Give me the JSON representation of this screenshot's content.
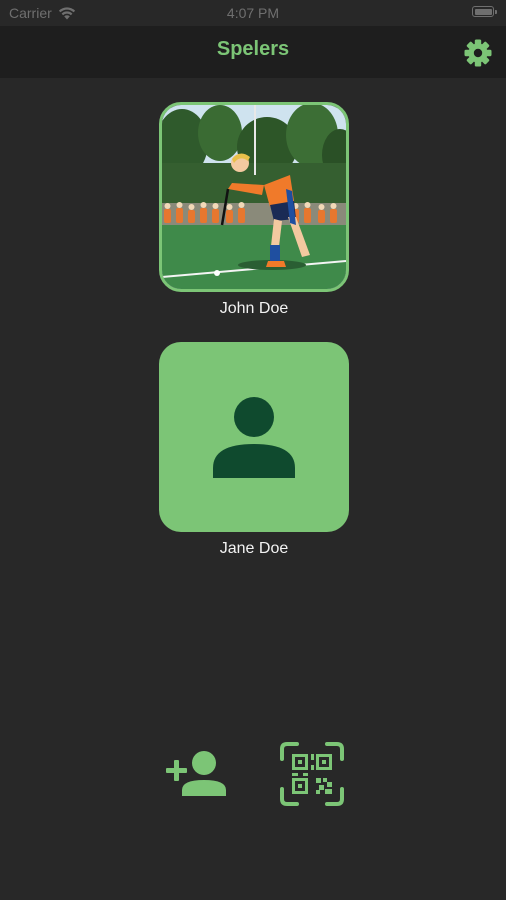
{
  "status_bar": {
    "carrier": "Carrier",
    "time": "4:07 PM"
  },
  "header": {
    "title": "Spelers",
    "settings_icon": "gear-icon"
  },
  "players": [
    {
      "name": "John Doe",
      "image": "photo of field hockey player"
    },
    {
      "name": "Jane Doe",
      "image": "default-avatar-icon"
    }
  ],
  "toolbar": {
    "add_icon": "add-person-icon",
    "scan_icon": "qr-code-scan-icon"
  },
  "colors": {
    "accent": "#7cc576",
    "avatar_figure": "#0f4a2e",
    "background": "#282828",
    "nav_background": "#1e1e1e",
    "text": "#f2f2f2"
  }
}
